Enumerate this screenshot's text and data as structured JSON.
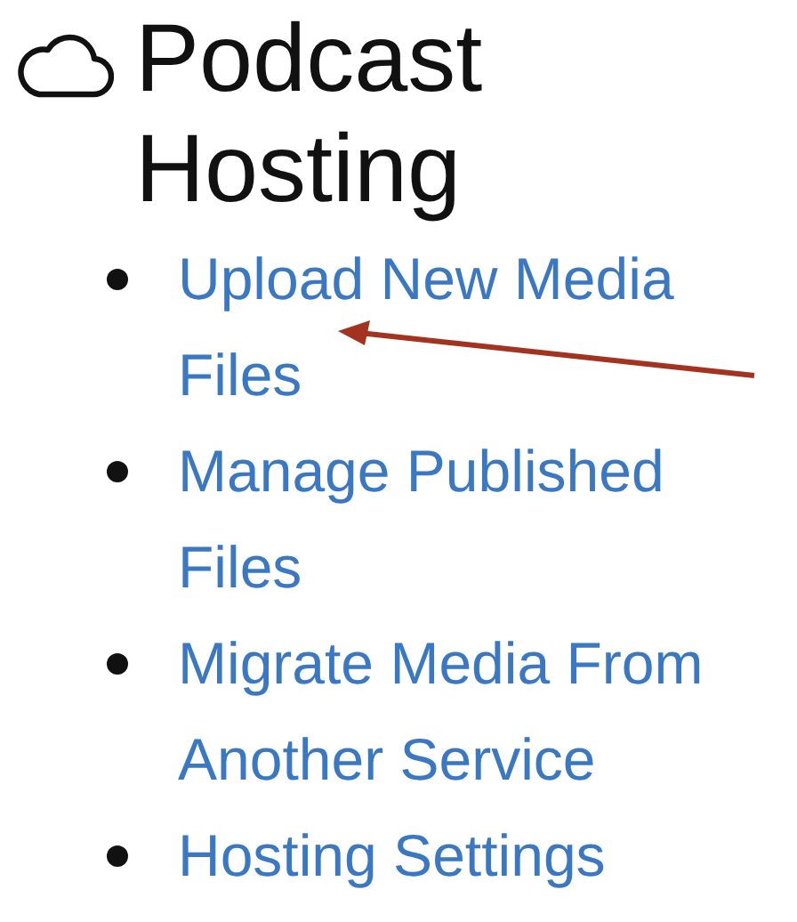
{
  "heading": {
    "title": "Podcast Hosting"
  },
  "links": [
    {
      "label": "Upload New Media Files"
    },
    {
      "label": "Manage Published Files"
    },
    {
      "label": "Migrate Media From Another Service"
    },
    {
      "label": "Hosting Settings"
    }
  ]
}
